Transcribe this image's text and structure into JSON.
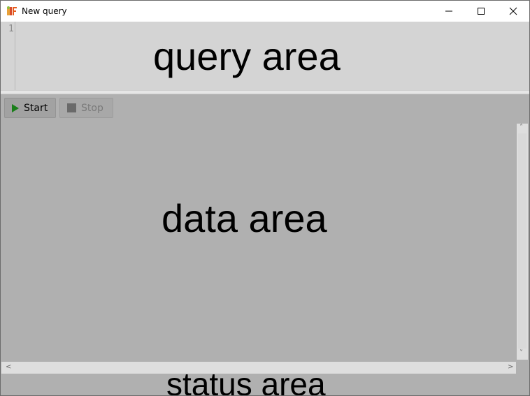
{
  "window": {
    "title": "New query",
    "app_icon": "app-logo-icon"
  },
  "window_controls": {
    "minimize_icon": "minimize-icon",
    "maximize_icon": "maximize-icon",
    "close_icon": "close-icon"
  },
  "editor": {
    "line_number": "1",
    "area_label": "query area"
  },
  "toolbar": {
    "start_label": "Start",
    "stop_label": "Stop",
    "start_icon": "play-icon",
    "stop_icon": "stop-icon",
    "start_icon_color": "#1a7f1a"
  },
  "data": {
    "area_label": "data area"
  },
  "status": {
    "area_label": "status area"
  },
  "scrollbars": {
    "up_arrow": "˄",
    "down_arrow": "˅",
    "left_arrow": "<",
    "right_arrow": ">"
  }
}
